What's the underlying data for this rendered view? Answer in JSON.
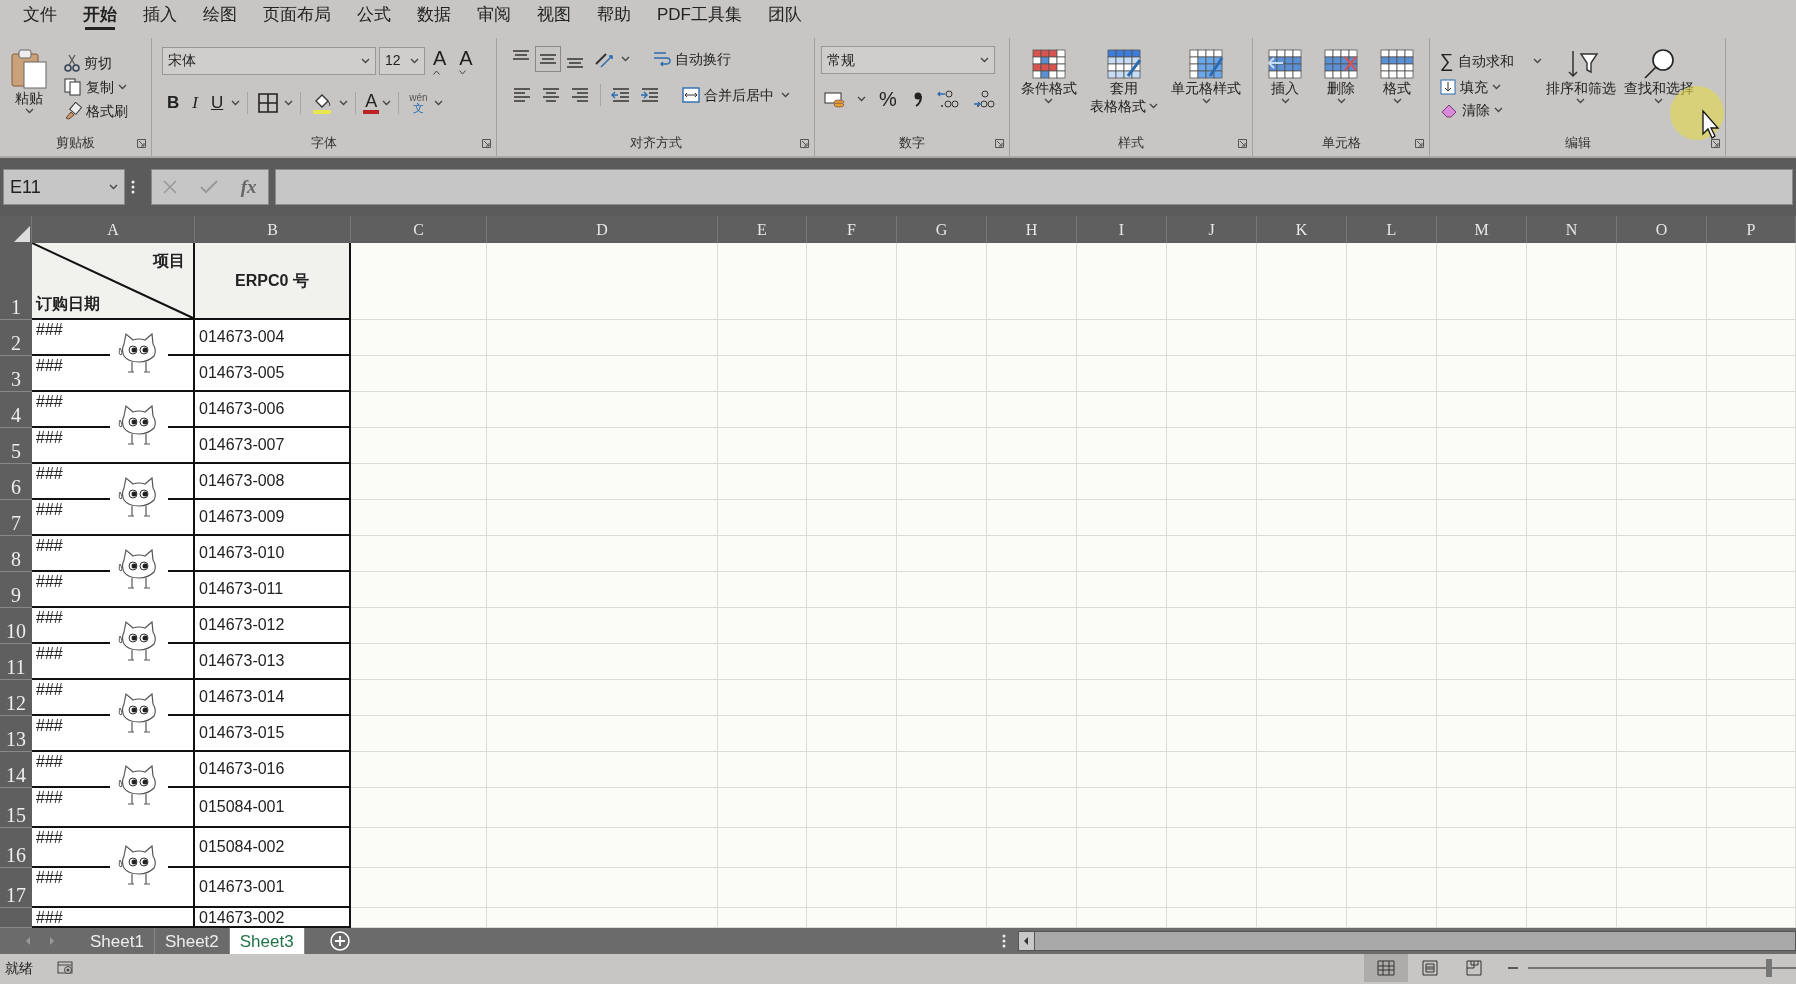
{
  "menu_tabs": [
    {
      "label": "文件",
      "selected": false
    },
    {
      "label": "开始",
      "selected": true
    },
    {
      "label": "插入",
      "selected": false
    },
    {
      "label": "绘图",
      "selected": false
    },
    {
      "label": "页面布局",
      "selected": false
    },
    {
      "label": "公式",
      "selected": false
    },
    {
      "label": "数据",
      "selected": false
    },
    {
      "label": "审阅",
      "selected": false
    },
    {
      "label": "视图",
      "selected": false
    },
    {
      "label": "帮助",
      "selected": false
    },
    {
      "label": "PDF工具集",
      "selected": false
    },
    {
      "label": "团队",
      "selected": false
    }
  ],
  "clipboard": {
    "paste": "粘贴",
    "cut": "剪切",
    "copy": "复制",
    "format_painter": "格式刷",
    "label": "剪贴板"
  },
  "font": {
    "name": "宋体",
    "size": "12",
    "grow": "A",
    "shrink": "A",
    "bold": "B",
    "italic": "I",
    "underline": "U",
    "font_color": "A",
    "phonetic_top": "wén",
    "phonetic_bottom": "文",
    "label": "字体"
  },
  "alignment": {
    "vertical": [
      {
        "kind": "top",
        "selected": false
      },
      {
        "kind": "middle",
        "selected": true
      },
      {
        "kind": "bottom",
        "selected": false
      }
    ],
    "wrap_text": "自动换行",
    "merge_center": "合并后居中",
    "label": "对齐方式"
  },
  "number": {
    "format": "常规",
    "percent": "%",
    "label": "数字"
  },
  "styles": {
    "items": [
      {
        "kind": "conditional",
        "label": "条件格式"
      },
      {
        "kind": "table",
        "label": "套用",
        "label_2": "表格格式"
      },
      {
        "kind": "cell",
        "label": "单元格样式"
      }
    ],
    "label": "样式"
  },
  "cells": {
    "items": [
      {
        "kind": "insert",
        "label": "插入"
      },
      {
        "kind": "delete",
        "label": "删除"
      },
      {
        "kind": "format",
        "label": "格式"
      }
    ],
    "label": "单元格"
  },
  "editing": {
    "autosum_glyph": "∑",
    "autosum": "自动求和",
    "fill": "填充",
    "clear": "清除",
    "sort_filter": "排序和筛选",
    "find_select": "查找和选择",
    "label": "编辑"
  },
  "formula_bar": {
    "name_box": "E11",
    "fx": "fx"
  },
  "sheet": {
    "columns": [
      "A",
      "B",
      "C",
      "D",
      "E",
      "F",
      "G",
      "H",
      "I",
      "J",
      "K",
      "L",
      "M",
      "N",
      "O",
      "P"
    ],
    "header": {
      "row_number": "1",
      "diagonal_top": "项目",
      "diagonal_bottom": "订购日期",
      "b": "ERPC0 号"
    },
    "rows": [
      {
        "row_number": "2",
        "a": "###",
        "b": "014673-004"
      },
      {
        "row_number": "3",
        "a": "###",
        "b": "014673-005"
      },
      {
        "row_number": "4",
        "a": "###",
        "b": "014673-006"
      },
      {
        "row_number": "5",
        "a": "###",
        "b": "014673-007"
      },
      {
        "row_number": "6",
        "a": "###",
        "b": "014673-008"
      },
      {
        "row_number": "7",
        "a": "###",
        "b": "014673-009"
      },
      {
        "row_number": "8",
        "a": "###",
        "b": "014673-010"
      },
      {
        "row_number": "9",
        "a": "###",
        "b": "014673-011"
      },
      {
        "row_number": "10",
        "a": "###",
        "b": "014673-012"
      },
      {
        "row_number": "11",
        "a": "###",
        "b": "014673-013"
      },
      {
        "row_number": "12",
        "a": "###",
        "b": "014673-014"
      },
      {
        "row_number": "13",
        "a": "###",
        "b": "014673-015"
      },
      {
        "row_number": "14",
        "a": "###",
        "b": "014673-016"
      },
      {
        "row_number": "15",
        "a": "###",
        "b": "015084-001"
      },
      {
        "row_number": "16",
        "a": "###",
        "b": "015084-002"
      },
      {
        "row_number": "17",
        "a": "###",
        "b": "014673-001"
      },
      {
        "a": "###",
        "b": "014673-002"
      }
    ]
  },
  "sheet_tabs": [
    {
      "label": "Sheet1",
      "selected": false
    },
    {
      "label": "Sheet2",
      "selected": false
    },
    {
      "label": "Sheet3",
      "selected": true
    }
  ],
  "status_bar": {
    "text": "就绪",
    "views": [
      {
        "kind": "normal",
        "selected": true
      },
      {
        "kind": "page_layout",
        "selected": false
      },
      {
        "kind": "page_break",
        "selected": false
      }
    ],
    "zoom_slider": {
      "level": 0.9
    }
  }
}
